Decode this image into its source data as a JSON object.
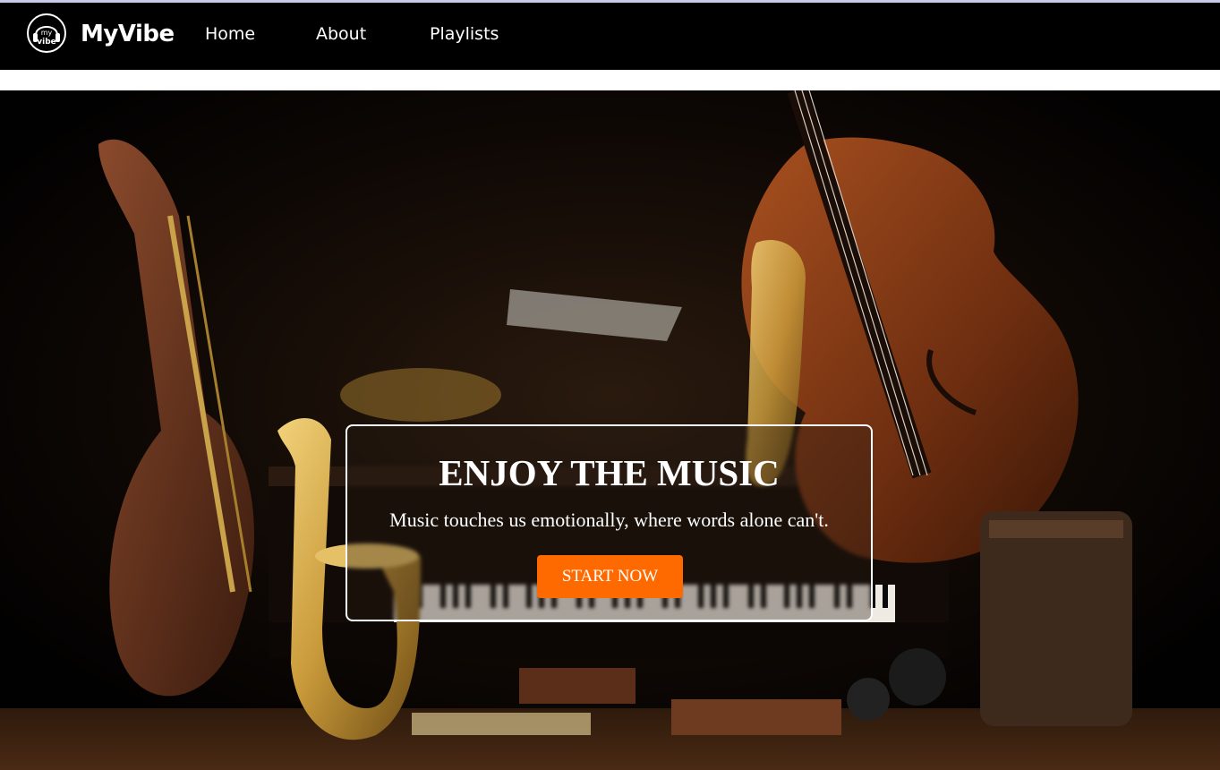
{
  "brand": {
    "name": "MyVibe",
    "logo_text_top": "my",
    "logo_text_bottom": "vibe",
    "logo_icon": "headphones-logo-icon"
  },
  "nav": {
    "items": [
      {
        "label": "Home"
      },
      {
        "label": "About"
      },
      {
        "label": "Playlists"
      }
    ]
  },
  "hero": {
    "background": "musical-instruments-image",
    "title": "ENJOY THE MUSIC",
    "subtitle": "Music touches us emotionally, where words alone can't.",
    "cta_label": "START NOW",
    "accent_color": "#ff6a00"
  }
}
